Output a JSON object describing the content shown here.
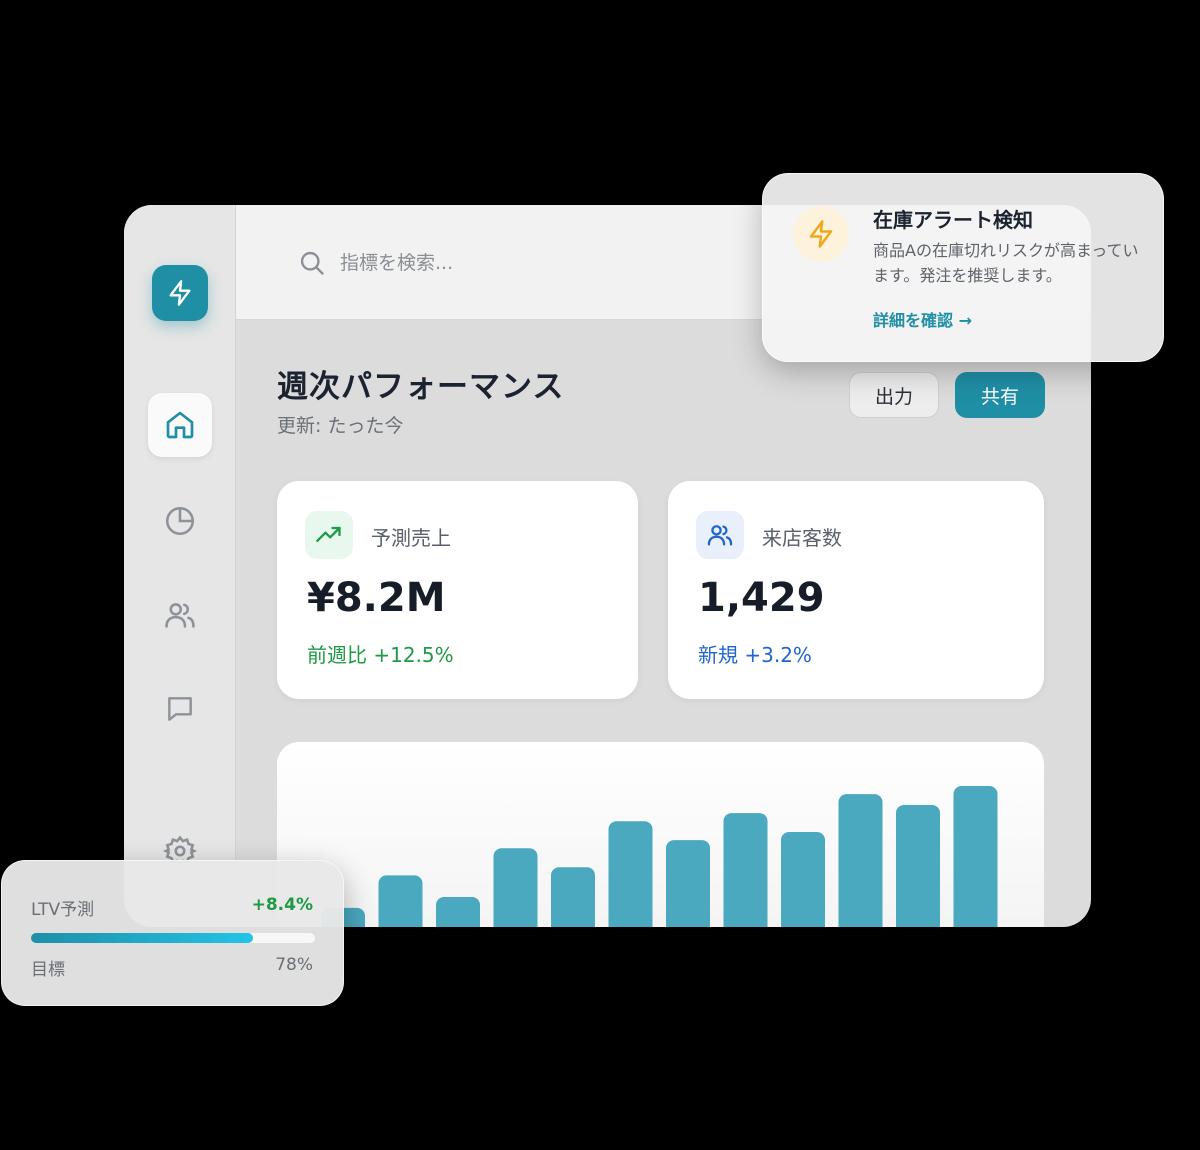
{
  "brand": {
    "icon": "bolt-icon",
    "color": "#1f8fa6"
  },
  "sidebar": {
    "items": [
      {
        "icon": "home-icon",
        "active": true
      },
      {
        "icon": "pie-chart-icon",
        "active": false
      },
      {
        "icon": "users-icon",
        "active": false
      },
      {
        "icon": "message-icon",
        "active": false
      },
      {
        "icon": "gear-icon",
        "active": false
      }
    ]
  },
  "search": {
    "placeholder": "指標を検索..."
  },
  "header": {
    "title": "週次パフォーマンス",
    "subtitle": "更新: たった今",
    "export_label": "出力",
    "share_label": "共有"
  },
  "cards": [
    {
      "icon": "trending-up-icon",
      "label": "予測売上",
      "value": "¥8.2M",
      "delta": "前週比 +12.5%",
      "color": "#1f9a45"
    },
    {
      "icon": "users-icon",
      "label": "来店客数",
      "value": "1,429",
      "delta": "新規 +3.2%",
      "color": "#2266cc"
    }
  ],
  "chart_data": {
    "type": "bar",
    "values": [
      20,
      32,
      24,
      42,
      35,
      52,
      45,
      55,
      48,
      62,
      58,
      65
    ],
    "color": "#4aa8bf"
  },
  "alert": {
    "icon": "bolt-icon",
    "title": "在庫アラート検知",
    "body": "商品Aの在庫切れリスクが高まっています。発注を推奨します。",
    "link": "詳細を確認 →"
  },
  "ltv": {
    "label": "LTV予測",
    "delta": "+8.4%",
    "target_label": "目標",
    "progress_text": "78%",
    "progress": 0.78
  }
}
